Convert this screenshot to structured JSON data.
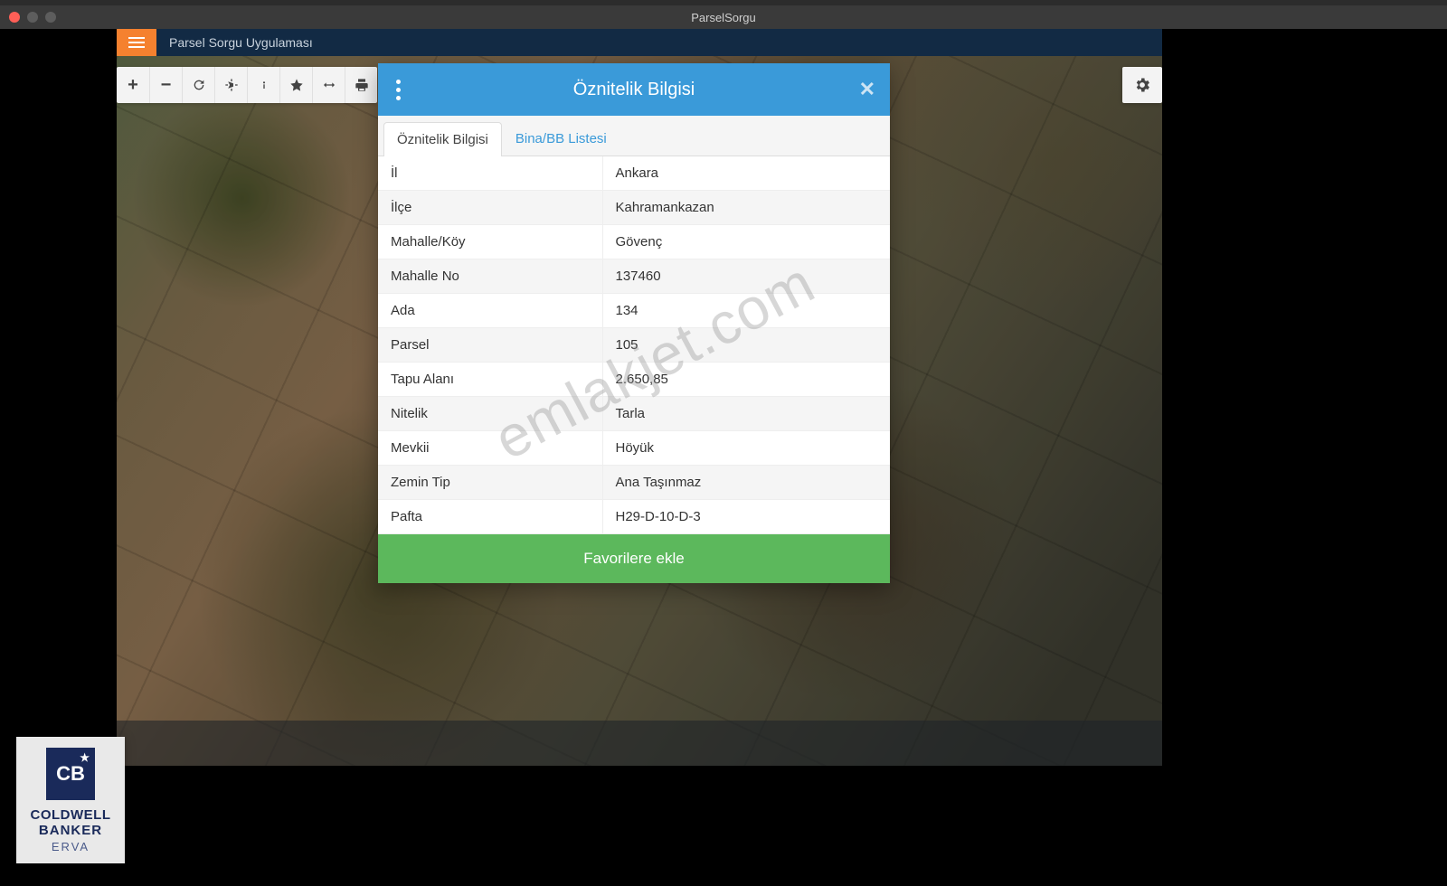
{
  "window": {
    "title": "ParselSorgu"
  },
  "app": {
    "title": "Parsel Sorgu Uygulaması"
  },
  "toolbar": {
    "zoom_in": "Yakınlaştır",
    "zoom_out": "Uzaklaştır",
    "refresh": "Yenile",
    "locate": "Konum",
    "info": "Bilgi",
    "favorite": "Favori",
    "fit": "Sığdır",
    "print": "Yazdır",
    "settings": "Ayarlar"
  },
  "modal": {
    "title": "Öznitelik Bilgisi",
    "tabs": {
      "attr": "Öznitelik Bilgisi",
      "bina": "Bina/BB Listesi"
    },
    "rows": [
      {
        "k": "İl",
        "v": "Ankara"
      },
      {
        "k": "İlçe",
        "v": "Kahramankazan"
      },
      {
        "k": "Mahalle/Köy",
        "v": "Gövenç"
      },
      {
        "k": "Mahalle No",
        "v": "137460"
      },
      {
        "k": "Ada",
        "v": "134"
      },
      {
        "k": "Parsel",
        "v": "105"
      },
      {
        "k": "Tapu Alanı",
        "v": "2.650,85"
      },
      {
        "k": "Nitelik",
        "v": "Tarla"
      },
      {
        "k": "Mevkii",
        "v": "Höyük"
      },
      {
        "k": "Zemin Tip",
        "v": "Ana Taşınmaz"
      },
      {
        "k": "Pafta",
        "v": "H29-D-10-D-3"
      }
    ],
    "favorites_button": "Favorilere ekle"
  },
  "watermark": "emlakjet.com",
  "badge": {
    "logo_letters": "CB",
    "line1": "COLDWELL",
    "line2": "BANKER",
    "sub": "ERVA"
  }
}
